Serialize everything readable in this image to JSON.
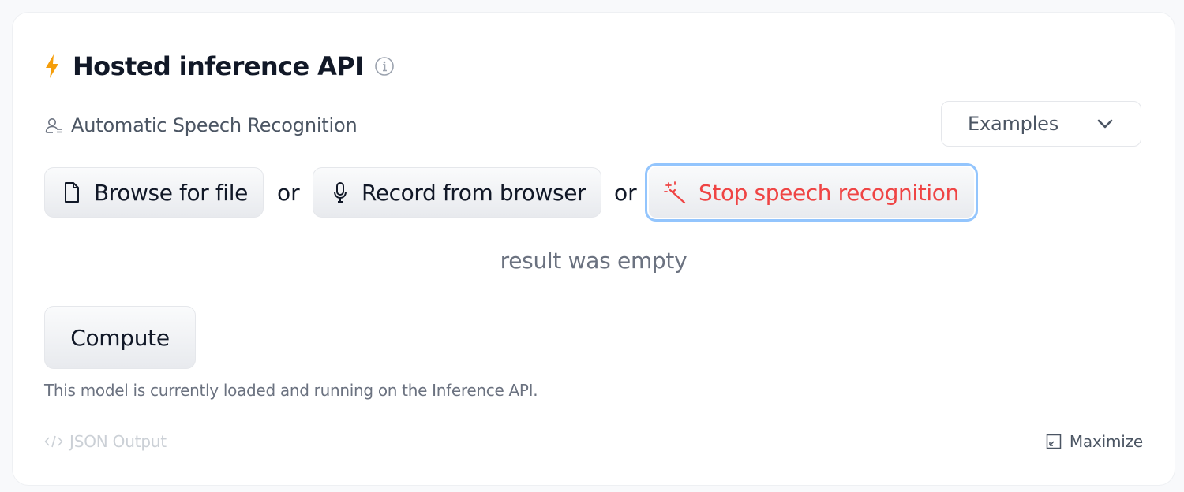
{
  "widget": {
    "title": "Hosted inference API",
    "task": "Automatic Speech Recognition",
    "examples_label": "Examples",
    "browse_label": "Browse for file",
    "or_1": "or",
    "record_label": "Record from browser",
    "or_2": "or",
    "stop_label": "Stop speech recognition",
    "result": "result was empty",
    "compute_label": "Compute",
    "status": "This model is currently loaded and running on the Inference API.",
    "json_output_label": "JSON Output",
    "maximize_label": "Maximize"
  },
  "icons": {
    "bolt": "bolt-icon",
    "info": "info-icon",
    "task": "person-icon",
    "examples": "chevron-down-icon",
    "browse": "file-icon",
    "record": "microphone-icon",
    "stop": "magic-wand-icon",
    "json": "code-icon",
    "maximize": "maximize-icon"
  },
  "colors": {
    "accent_bolt": "#f59e0b",
    "stop_text": "#ef4444",
    "focus_ring": "#93c5fd"
  }
}
